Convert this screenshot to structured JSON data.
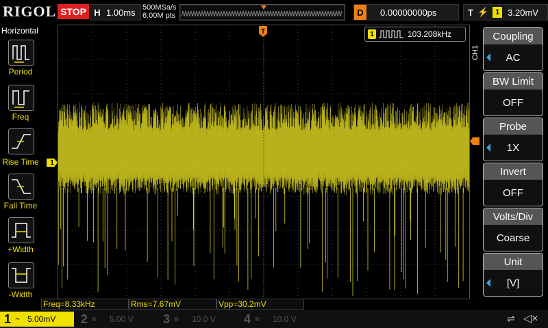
{
  "topbar": {
    "brand": "RIGOL",
    "run_state": "STOP",
    "timebase_letter": "H",
    "timebase": "1.00ms",
    "sample_rate": "500MSa/s",
    "memory_depth": "6.00M pts",
    "delay_letter": "D",
    "delay": "0.00000000ps",
    "trigger_letter": "T",
    "trigger_source": "1",
    "trigger_level": "3.20mV"
  },
  "left_panel": {
    "title": "Horizontal",
    "items": [
      {
        "label": "Period",
        "icon": "period-icon"
      },
      {
        "label": "Freq",
        "icon": "freq-icon"
      },
      {
        "label": "Rise Time",
        "icon": "rise-time-icon"
      },
      {
        "label": "Fall Time",
        "icon": "fall-time-icon"
      },
      {
        "label": "+Width",
        "icon": "pos-width-icon"
      },
      {
        "label": "-Width",
        "icon": "neg-width-icon"
      }
    ]
  },
  "frequency_counter": {
    "channel": "1",
    "value": "103.208kHz"
  },
  "right_panel": {
    "channel_tag": "CH1",
    "items": [
      {
        "title": "Coupling",
        "value": "AC"
      },
      {
        "title": "BW Limit",
        "value": "OFF"
      },
      {
        "title": "Probe",
        "value": "1X"
      },
      {
        "title": "Invert",
        "value": "OFF"
      },
      {
        "title": "Volts/Div",
        "value": "Coarse"
      },
      {
        "title": "Unit",
        "value": "[V]"
      }
    ]
  },
  "measurements": {
    "freq": "Freq=8.33kHz",
    "rms": "Rms=7.67mV",
    "vpp": "Vpp=30.2mV"
  },
  "channels": [
    {
      "num": "1",
      "coupling": "~",
      "scale": "5.00mV",
      "color": "#f0e000"
    },
    {
      "num": "2",
      "coupling": "≡",
      "scale": "5.00 V",
      "color": "#00c0c0"
    },
    {
      "num": "3",
      "coupling": "≡",
      "scale": "10.0 V",
      "color": "#d040d0"
    },
    {
      "num": "4",
      "coupling": "≡",
      "scale": "10.0 V",
      "color": "#3070f0"
    }
  ],
  "markers": {
    "ch1_ground": "1",
    "trigger_marker": "T"
  },
  "colors": {
    "trace": "#d8d020",
    "trigger": "#f08010",
    "accent": "#2fa8e8"
  }
}
